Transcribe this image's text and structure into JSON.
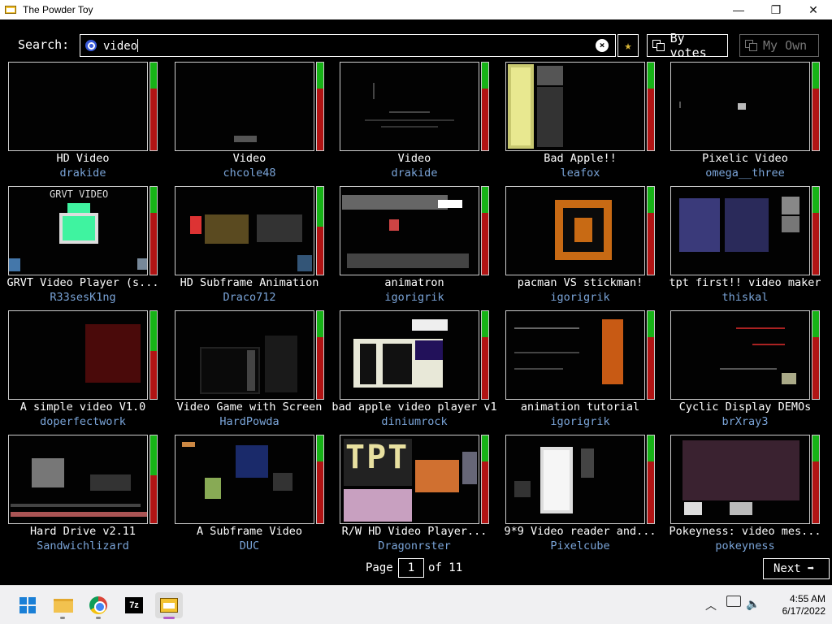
{
  "window": {
    "title": "The Powder Toy",
    "minimize": "—",
    "maximize": "❐",
    "close": "✕"
  },
  "search": {
    "label": "Search:",
    "value": "video",
    "clear_icon": "⊗",
    "fav_icon": "★",
    "sort_button": "By votes",
    "myown_button": "My Own"
  },
  "saves": [
    {
      "name": "HD Video",
      "author": "drakide",
      "votes_up_fraction": 0.3
    },
    {
      "name": "Video",
      "author": "chcole48",
      "votes_up_fraction": 0.3
    },
    {
      "name": "Video",
      "author": "drakide",
      "votes_up_fraction": 0.3
    },
    {
      "name": "Bad Apple!!",
      "author": "leafox",
      "votes_up_fraction": 0.3
    },
    {
      "name": "Pixelic Video",
      "author": "omega__three",
      "votes_up_fraction": 0.3
    },
    {
      "name": "GRVT Video Player (s...",
      "author": "R33sesK1ng",
      "votes_up_fraction": 0.3
    },
    {
      "name": "HD Subframe Animation",
      "author": "Draco712",
      "votes_up_fraction": 0.45
    },
    {
      "name": "animatron",
      "author": "igorigrik",
      "votes_up_fraction": 0.3
    },
    {
      "name": "pacman VS stickman!",
      "author": "igorigrik",
      "votes_up_fraction": 0.3
    },
    {
      "name": "tpt first!! video maker",
      "author": "thiskal",
      "votes_up_fraction": 0.3
    },
    {
      "name": "A simple video V1.0",
      "author": "doperfectwork",
      "votes_up_fraction": 0.45
    },
    {
      "name": "Video Game with Screen",
      "author": "HardPowda",
      "votes_up_fraction": 0.3
    },
    {
      "name": "bad apple video player v1",
      "author": "diniumrock",
      "votes_up_fraction": 0.3
    },
    {
      "name": "animation tutorial",
      "author": "igorigrik",
      "votes_up_fraction": 0.3
    },
    {
      "name": "Cyclic Display DEMOs",
      "author": "brXray3",
      "votes_up_fraction": 0.3
    },
    {
      "name": "Hard Drive v2.11",
      "author": "Sandwichlizard",
      "votes_up_fraction": 0.45
    },
    {
      "name": "A Subframe Video",
      "author": "DUC",
      "votes_up_fraction": 0.3
    },
    {
      "name": "R/W HD Video Player...",
      "author": "Dragonrster",
      "votes_up_fraction": 0.3
    },
    {
      "name": "9*9 Video reader and...",
      "author": "Pixelcube",
      "votes_up_fraction": 0.3
    },
    {
      "name": "Pokeyness: video mes...",
      "author": "pokeyness",
      "votes_up_fraction": 0.3
    }
  ],
  "thumb_texts": {
    "grvt_title": "GRVT VIDEO",
    "tpt_logo": "TPT"
  },
  "pager": {
    "page_label": "Page",
    "page_value": "1",
    "of_label": "of 11",
    "next_label": "Next",
    "next_icon": "➡"
  },
  "taskbar": {
    "time": "4:55 AM",
    "date": "6/17/2022",
    "chevron_icon": "︿",
    "network_icon": "▭",
    "volume_icon": "🔈",
    "sevenzip_label": "7z"
  },
  "colors": {
    "vote_up": "#17b317",
    "vote_down": "#b11414",
    "author": "#7aa4d8"
  }
}
